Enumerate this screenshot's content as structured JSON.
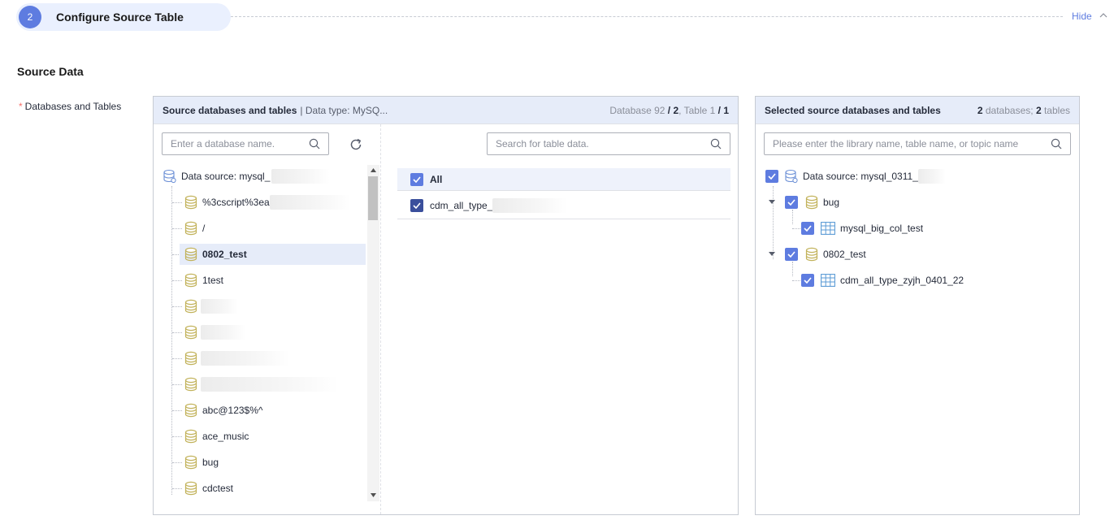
{
  "step": {
    "number": "2",
    "title": "Configure Source Table",
    "hide_label": "Hide"
  },
  "section_title": "Source Data",
  "field_label": "Databases and Tables",
  "required_mark": "*",
  "source_panel": {
    "title": "Source databases and tables",
    "subtitle": "| Data type: MySQ...",
    "stat_db_label": "Database",
    "stat_db_total": "92",
    "stat_db_selected": "/ 2",
    "stat_table_label": "Table",
    "stat_table_total": "1",
    "stat_table_selected": "/ 1",
    "db_search_placeholder": "Enter a database name.",
    "table_search_placeholder": "Search for table data.",
    "datasource_label": "Data source: mysql_",
    "databases": [
      {
        "name": "%3cscript%3ea",
        "blurred": true
      },
      {
        "name": "/",
        "blurred": false
      },
      {
        "name": "0802_test",
        "blurred": false,
        "selected": true
      },
      {
        "name": "1test",
        "blurred": false
      },
      {
        "name": "",
        "blurred": true
      },
      {
        "name": "",
        "blurred": true
      },
      {
        "name": "",
        "blurred": true
      },
      {
        "name": "",
        "blurred": true
      },
      {
        "name": "abc@123$%^",
        "blurred": false
      },
      {
        "name": "ace_music",
        "blurred": false
      },
      {
        "name": "bug",
        "blurred": false
      },
      {
        "name": "cdctest",
        "blurred": false
      }
    ],
    "table_all_label": "All",
    "tables": [
      {
        "name": "cdm_all_type_",
        "checked": true
      }
    ]
  },
  "selected_panel": {
    "title": "Selected source databases and tables",
    "count_db": "2",
    "count_db_label": "databases;",
    "count_tables": "2",
    "count_tables_label": "tables",
    "search_placeholder": "Please enter the library name, table name, or topic name",
    "datasource_label": "Data source: mysql_0311_",
    "tree": [
      {
        "db": "bug",
        "tables": [
          "mysql_big_col_test"
        ]
      },
      {
        "db": "0802_test",
        "tables": [
          "cdm_all_type_zyjh_0401_22"
        ]
      }
    ]
  },
  "colors": {
    "accent": "#5e7ce0",
    "header_bg": "#e6ecf9",
    "db_icon": "#c2b25a",
    "table_icon": "#5b9bd5"
  }
}
